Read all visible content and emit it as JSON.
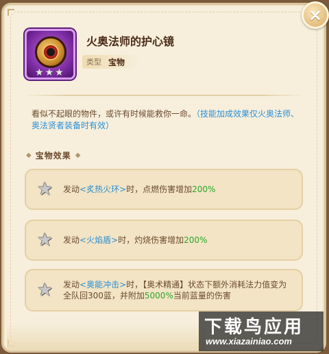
{
  "close_button": {
    "label": "×"
  },
  "item": {
    "name": "火奥法师的护心镜",
    "type_label": "类型",
    "type_value": "宝物",
    "star_count": 3,
    "frame_color": "#7a2aa0"
  },
  "description": {
    "text": "看似不起眼的物件，或许有时候能救你一命。",
    "highlight": "（技能加成效果仅火奥法师、奥法贤者装备时有效）"
  },
  "section_title": "宝物效果",
  "effects": [
    {
      "prefix": "发动",
      "skill": "<炙热火环>",
      "mid": "时，点燃伤害增加",
      "value": "200%",
      "suffix": ""
    },
    {
      "prefix": "发动",
      "skill": "<火焰盾>",
      "mid": "时，灼烧伤害增加",
      "value": "200%",
      "suffix": ""
    },
    {
      "prefix": "发动",
      "skill": "<奥能冲击>",
      "mid": "时，【奥术精通】状态下额外消耗法力值变为全队回300蓝，并附加",
      "value": "5000%",
      "suffix": "当前蓝量的伤害"
    }
  ],
  "watermark": {
    "title": "下载鸟应用",
    "url": "www.xiazainiao.com"
  },
  "colors": {
    "skill": "#2a8fd6",
    "number": "#2ca52c",
    "text": "#6b4a2e",
    "title": "#4a2c17"
  }
}
